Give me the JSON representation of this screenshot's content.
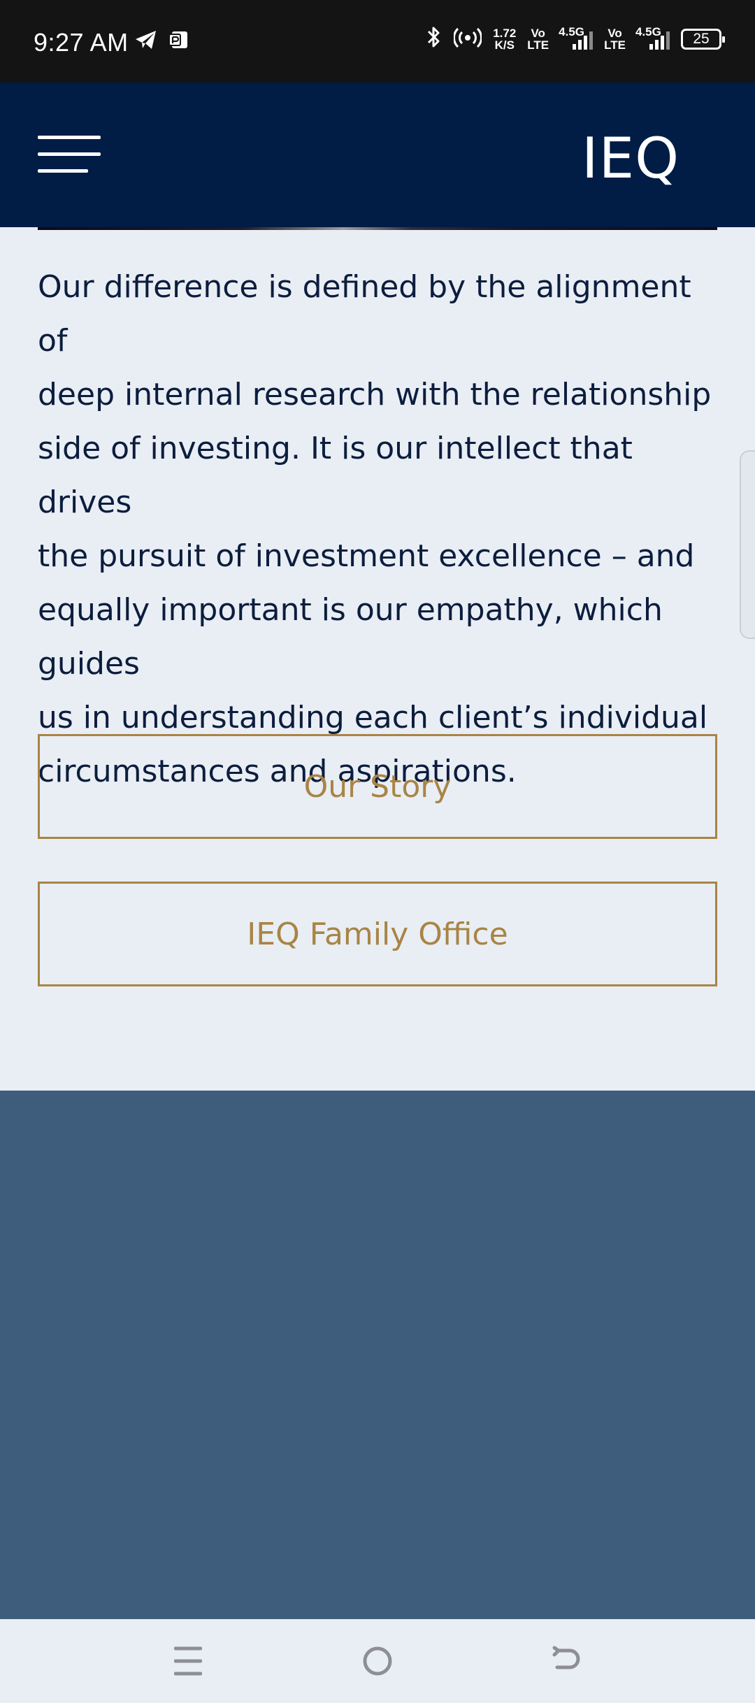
{
  "status_bar": {
    "time": "9:27 AM",
    "net_speed_value": "1.72",
    "net_speed_unit": "K/S",
    "sim1_top": "Vo",
    "sim1_bottom": "LTE",
    "sim1_network": "4.5G",
    "sim2_top": "Vo",
    "sim2_bottom": "LTE",
    "sim2_network": "4.5G",
    "battery_level": "25",
    "icons": [
      "telegram-icon",
      "app-notification-icon",
      "bluetooth-icon",
      "hotspot-icon",
      "signal-icon",
      "battery-icon"
    ]
  },
  "header": {
    "logo": "IEQ",
    "menu_icon": "hamburger-menu-icon"
  },
  "main": {
    "intro_lines": [
      "Our difference is defined by the alignment of",
      "deep internal research with the relationship",
      "side of investing. It is our intellect that drives",
      "the pursuit of investment excellence – and",
      "equally important is our empathy, which guides",
      "us in understanding each client’s individual",
      "circumstances and aspirations."
    ],
    "buttons": {
      "our_story": "Our Story",
      "family_office": "IEQ Family Office"
    }
  },
  "nav_bar": {
    "icons": [
      "recent-apps-icon",
      "home-icon",
      "back-icon"
    ]
  },
  "colors": {
    "header_bg": "#011c45",
    "page_bg": "#e9eef5",
    "text": "#0c1d3d",
    "accent_gold": "#a98445",
    "section_blue": "#3e5c7b",
    "status_bg": "#141414"
  }
}
